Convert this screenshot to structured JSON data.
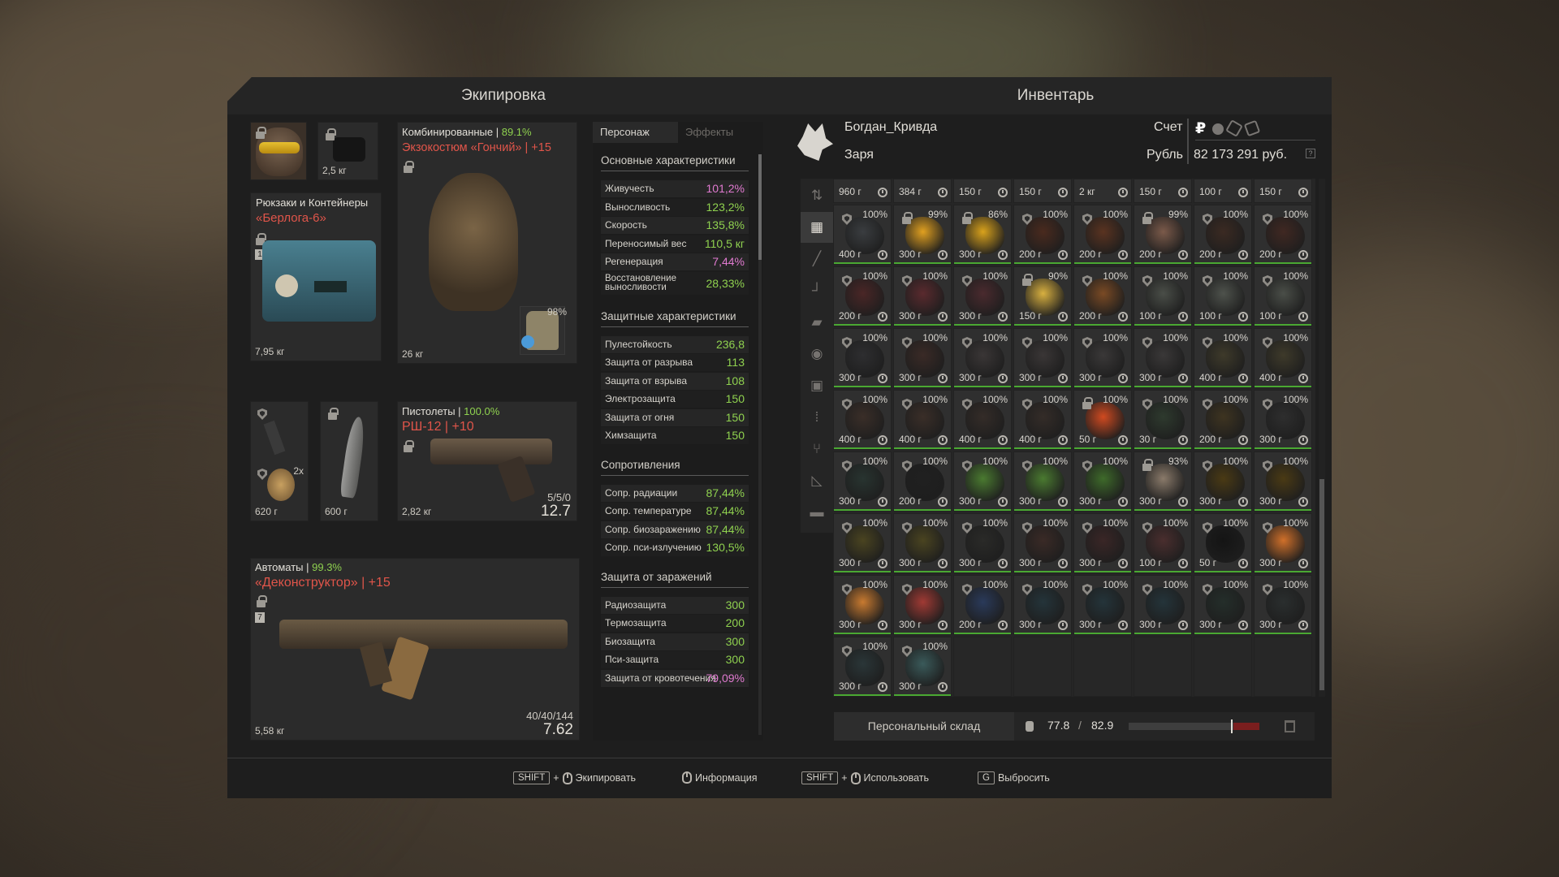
{
  "equipment": {
    "title": "Экипировка",
    "helmet_slot": {
      "weight": ""
    },
    "device_slot": {
      "weight": "2,5 кг"
    },
    "backpack": {
      "category": "Рюкзаки и Контейнеры",
      "name": "«Берлога-6»",
      "level": "1",
      "weight": "7,95 кг"
    },
    "armor": {
      "category": "Комбинированные",
      "durability": "89.1%",
      "name": "Экзокостюм «Гончий» | +15",
      "weight": "26 кг",
      "plate_pct": "98%"
    },
    "grenade_slot": {
      "count": "2x",
      "weight": "620 г"
    },
    "melee_slot": {
      "weight": "600 г"
    },
    "pistol": {
      "category": "Пистолеты",
      "durability": "100.0%",
      "name": "РШ-12 | +10",
      "weight": "2,82 кг",
      "ammo": "5/5/0",
      "caliber": "12.7"
    },
    "rifle": {
      "category": "Автоматы",
      "durability": "99.3%",
      "name": "«Деконструктор» | +15",
      "level": "7",
      "weight": "5,58 кг",
      "ammo": "40/40/144",
      "caliber": "7.62"
    }
  },
  "stats": {
    "tabs": [
      "Персонаж",
      "Эффекты"
    ],
    "sections": [
      {
        "title": "Основные характеристики",
        "rows": [
          {
            "label": "Живучесть",
            "value": "101,2%",
            "color": "pink"
          },
          {
            "label": "Выносливость",
            "value": "123,2%",
            "color": "green"
          },
          {
            "label": "Скорость",
            "value": "135,8%",
            "color": "green"
          },
          {
            "label": "Переносимый вес",
            "value": "110,5 кг",
            "color": "green"
          },
          {
            "label": "Регенерация",
            "value": "7,44%",
            "color": "pink"
          },
          {
            "label": "Восстановление выносливости",
            "value": "28,33%",
            "color": "green"
          }
        ]
      },
      {
        "title": "Защитные характеристики",
        "rows": [
          {
            "label": "Пулестойкость",
            "value": "236,8",
            "color": "green"
          },
          {
            "label": "Защита от разрыва",
            "value": "113",
            "color": "green"
          },
          {
            "label": "Защита от взрыва",
            "value": "108",
            "color": "green"
          },
          {
            "label": "Электрозащита",
            "value": "150",
            "color": "green"
          },
          {
            "label": "Защита от огня",
            "value": "150",
            "color": "green"
          },
          {
            "label": "Химзащита",
            "value": "150",
            "color": "green"
          }
        ]
      },
      {
        "title": "Сопротивления",
        "rows": [
          {
            "label": "Сопр. радиации",
            "value": "87,44%",
            "color": "green"
          },
          {
            "label": "Сопр. температуре",
            "value": "87,44%",
            "color": "green"
          },
          {
            "label": "Сопр. биозаражению",
            "value": "87,44%",
            "color": "green"
          },
          {
            "label": "Сопр. пси-излучению",
            "value": "130,5%",
            "color": "green"
          }
        ]
      },
      {
        "title": "Защита от заражений",
        "rows": [
          {
            "label": "Радиозащита",
            "value": "300",
            "color": "green"
          },
          {
            "label": "Термозащита",
            "value": "200",
            "color": "green"
          },
          {
            "label": "Биозащита",
            "value": "300",
            "color": "green"
          },
          {
            "label": "Пси-защита",
            "value": "300",
            "color": "green"
          },
          {
            "label": "Защита от кровотечения",
            "value": "79,09%",
            "color": "pink"
          }
        ]
      }
    ]
  },
  "inventory": {
    "title": "Инвентарь",
    "player": "Богдан_Кривда",
    "faction": "Заря",
    "account_label": "Счет",
    "currency_label": "Рубль",
    "balance": "82 173 291 руб.",
    "top_row_weights": [
      "960 г",
      "384 г",
      "150 г",
      "150 г",
      "2 кг",
      "150 г",
      "100 г",
      "150 г"
    ],
    "rows": [
      [
        {
          "p": "100%",
          "w": "400 г",
          "c": "#3a3d40",
          "s": 1
        },
        {
          "p": "99%",
          "w": "300 г",
          "c": "#e0a020",
          "l": 1
        },
        {
          "p": "86%",
          "w": "300 г",
          "c": "#d9a21c",
          "l": 1
        },
        {
          "p": "100%",
          "w": "200 г",
          "c": "#4a2a1e",
          "s": 1
        },
        {
          "p": "100%",
          "w": "200 г",
          "c": "#5a3320",
          "s": 1
        },
        {
          "p": "99%",
          "w": "200 г",
          "c": "#7b5a4a",
          "l": 1
        },
        {
          "p": "100%",
          "w": "200 г",
          "c": "#3b2a22",
          "s": 1
        },
        {
          "p": "100%",
          "w": "200 г",
          "c": "#402822",
          "s": 1
        }
      ],
      [
        {
          "p": "100%",
          "w": "200 г",
          "c": "#4a2626",
          "s": 1
        },
        {
          "p": "100%",
          "w": "300 г",
          "c": "#5a2a2e",
          "s": 1
        },
        {
          "p": "100%",
          "w": "300 г",
          "c": "#4a2a2e",
          "s": 1
        },
        {
          "p": "90%",
          "w": "150 г",
          "c": "#d8b040",
          "l": 1
        },
        {
          "p": "100%",
          "w": "200 г",
          "c": "#7a4a24",
          "s": 1
        },
        {
          "p": "100%",
          "w": "100 г",
          "c": "#4a4e48",
          "s": 1
        },
        {
          "p": "100%",
          "w": "100 г",
          "c": "#4e524c",
          "s": 1
        },
        {
          "p": "100%",
          "w": "100 г",
          "c": "#4a4e48",
          "s": 1
        }
      ],
      [
        {
          "p": "100%",
          "w": "300 г",
          "c": "#2e2e30",
          "s": 1
        },
        {
          "p": "100%",
          "w": "300 г",
          "c": "#3a2a26",
          "s": 1
        },
        {
          "p": "100%",
          "w": "300 г",
          "c": "#3a3636",
          "s": 1
        },
        {
          "p": "100%",
          "w": "300 г",
          "c": "#3a3636",
          "s": 1
        },
        {
          "p": "100%",
          "w": "300 г",
          "c": "#3a3838",
          "s": 1
        },
        {
          "p": "100%",
          "w": "300 г",
          "c": "#3a3838",
          "s": 1
        },
        {
          "p": "100%",
          "w": "400 г",
          "c": "#3e3a2a",
          "s": 1
        },
        {
          "p": "100%",
          "w": "400 г",
          "c": "#3e3a2a",
          "s": 1
        }
      ],
      [
        {
          "p": "100%",
          "w": "400 г",
          "c": "#3a2e28",
          "s": 1
        },
        {
          "p": "100%",
          "w": "400 г",
          "c": "#3a2e28",
          "s": 1
        },
        {
          "p": "100%",
          "w": "400 г",
          "c": "#342c28",
          "s": 1
        },
        {
          "p": "100%",
          "w": "400 г",
          "c": "#342c28",
          "s": 1
        },
        {
          "p": "100%",
          "w": "50 г",
          "c": "#d04a20",
          "l": 1
        },
        {
          "p": "100%",
          "w": "30 г",
          "c": "#2e3a2e",
          "s": 1
        },
        {
          "p": "100%",
          "w": "200 г",
          "c": "#3e3420",
          "s": 1
        },
        {
          "p": "100%",
          "w": "300 г",
          "c": "#2e2e2e",
          "s": 1
        }
      ],
      [
        {
          "p": "100%",
          "w": "300 г",
          "c": "#283430",
          "s": 1
        },
        {
          "p": "100%",
          "w": "200 г",
          "c": "#202020",
          "s": 1
        },
        {
          "p": "100%",
          "w": "300 г",
          "c": "#4a7a30",
          "s": 1
        },
        {
          "p": "100%",
          "w": "300 г",
          "c": "#4a7a30",
          "s": 1
        },
        {
          "p": "100%",
          "w": "300 г",
          "c": "#3e6a2a",
          "s": 1
        },
        {
          "p": "93%",
          "w": "300 г",
          "c": "#8a7a6a",
          "l": 1
        },
        {
          "p": "100%",
          "w": "300 г",
          "c": "#4a3a14",
          "s": 1
        },
        {
          "p": "100%",
          "w": "300 г",
          "c": "#4a3a14",
          "s": 1
        }
      ],
      [
        {
          "p": "100%",
          "w": "300 г",
          "c": "#4a4420",
          "s": 1
        },
        {
          "p": "100%",
          "w": "300 г",
          "c": "#4a4420",
          "s": 1
        },
        {
          "p": "100%",
          "w": "300 г",
          "c": "#2a2a28",
          "s": 1
        },
        {
          "p": "100%",
          "w": "300 г",
          "c": "#3a2a26",
          "s": 1
        },
        {
          "p": "100%",
          "w": "300 г",
          "c": "#3a2626",
          "s": 1
        },
        {
          "p": "100%",
          "w": "100 г",
          "c": "#4a2e2e",
          "s": 1
        },
        {
          "p": "100%",
          "w": "50 г",
          "c": "#141414",
          "s": 1
        },
        {
          "p": "100%",
          "w": "300 г",
          "c": "#d0702a",
          "s": 1
        }
      ],
      [
        {
          "p": "100%",
          "w": "300 г",
          "c": "#c87a30",
          "s": 1
        },
        {
          "p": "100%",
          "w": "300 г",
          "c": "#a03a34",
          "s": 1
        },
        {
          "p": "100%",
          "w": "200 г",
          "c": "#2a3a5a",
          "s": 1
        },
        {
          "p": "100%",
          "w": "300 г",
          "c": "#24343a",
          "s": 1
        },
        {
          "p": "100%",
          "w": "300 г",
          "c": "#24343a",
          "s": 1
        },
        {
          "p": "100%",
          "w": "300 г",
          "c": "#24343a",
          "s": 1
        },
        {
          "p": "100%",
          "w": "300 г",
          "c": "#242e2a",
          "s": 1
        },
        {
          "p": "100%",
          "w": "300 г",
          "c": "#2a2e2e",
          "s": 1
        }
      ],
      [
        {
          "p": "100%",
          "w": "300 г",
          "c": "#2a3638",
          "s": 1
        },
        {
          "p": "100%",
          "w": "300 г",
          "c": "#3a5a5a",
          "s": 1
        }
      ]
    ],
    "storage_label": "Персональный склад",
    "weight_current": "77.8",
    "weight_sep": "/",
    "weight_max": "82.9",
    "weight_fill": 0.78
  },
  "footer": {
    "hints": [
      {
        "key": "SHIFT",
        "plus": "+",
        "mouse": true,
        "label": "Экипировать"
      },
      {
        "key": "",
        "plus": "",
        "mouse": true,
        "label": "Информация"
      },
      {
        "key": "SHIFT",
        "plus": "+",
        "mouse": true,
        "label": "Использовать"
      },
      {
        "key": "G",
        "plus": "",
        "mouse": false,
        "label": "Выбросить"
      }
    ]
  },
  "sidebar_icons": [
    "sort-icon",
    "grid-icon",
    "rifle-icon",
    "pistol-icon",
    "ammo-icon",
    "artifact-icon",
    "device-icon",
    "bottles-icon",
    "tools-icon",
    "ruler-icon",
    "box-icon"
  ]
}
